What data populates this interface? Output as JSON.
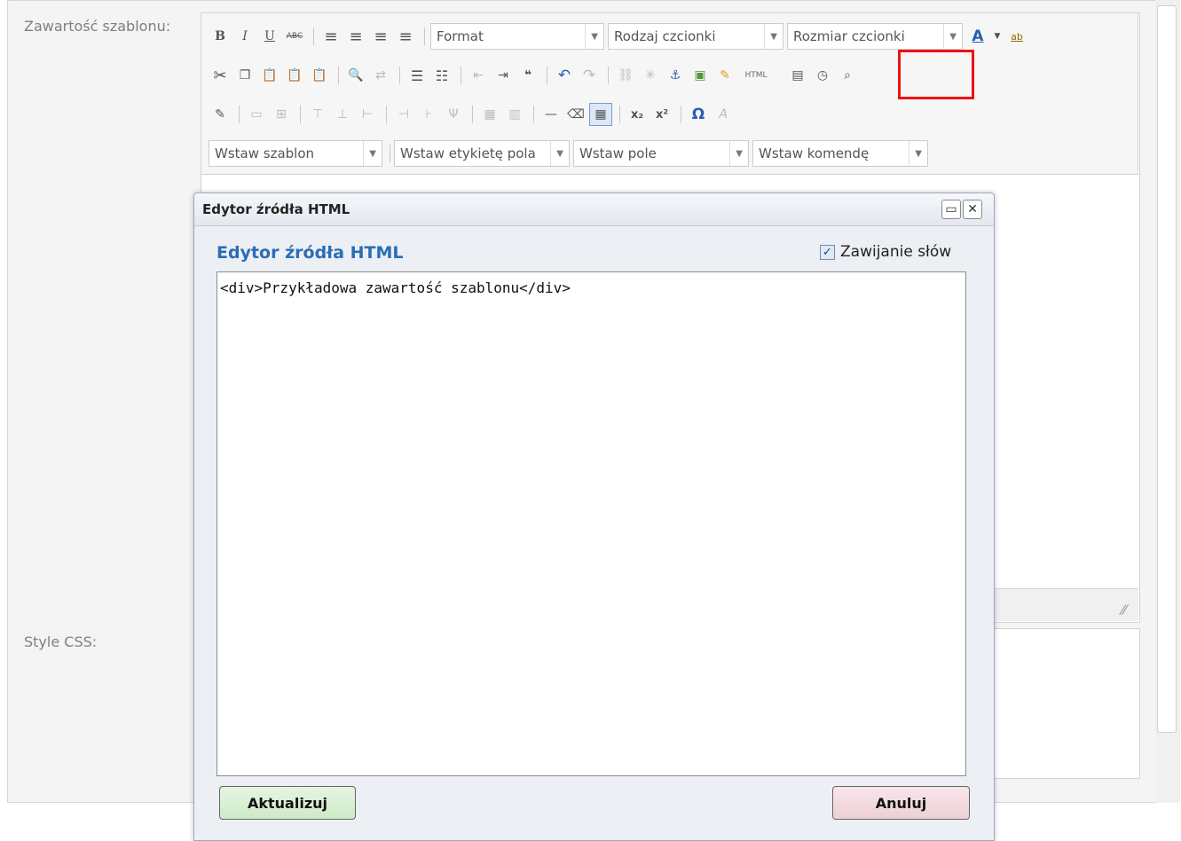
{
  "form": {
    "content_label": "Zawartość szablonu:",
    "css_label": "Style CSS:"
  },
  "toolbar": {
    "row1_buttons": [
      {
        "icon": "bold-icon",
        "glyph": "B"
      },
      {
        "icon": "italic-icon",
        "glyph": "I"
      },
      {
        "icon": "underline-icon",
        "glyph": "U"
      },
      {
        "icon": "strikethrough-icon",
        "glyph": "ABC"
      },
      {
        "icon": "align-left-icon",
        "glyph": "≡"
      },
      {
        "icon": "align-center-icon",
        "glyph": "≡"
      },
      {
        "icon": "align-right-icon",
        "glyph": "≡"
      },
      {
        "icon": "align-justify-icon",
        "glyph": "≡"
      }
    ],
    "format_combo": "Format",
    "font_family_combo": "Rodzaj czcionki",
    "font_size_combo": "Rozmiar czcionki",
    "text_color_glyph": "A",
    "highlight_glyph": "ab",
    "html_button_label": "HTML",
    "insert_template_combo": "Wstaw szablon",
    "insert_field_label_combo": "Wstaw etykietę pola",
    "insert_field_combo": "Wstaw pole",
    "insert_command_combo": "Wstaw komendę",
    "omega_glyph": "Ω",
    "subscript_glyph": "x₂",
    "superscript_glyph": "x²"
  },
  "dialog": {
    "title": "Edytor źródła HTML",
    "heading": "Edytor źródła HTML",
    "word_wrap_label": "Zawijanie słów",
    "word_wrap_checked": true,
    "source_code": "<div>Przykładowa zawartość szablonu</div>",
    "update_button": "Aktualizuj",
    "cancel_button": "Anuluj",
    "maximize_glyph": "▭",
    "close_glyph": "✕"
  }
}
